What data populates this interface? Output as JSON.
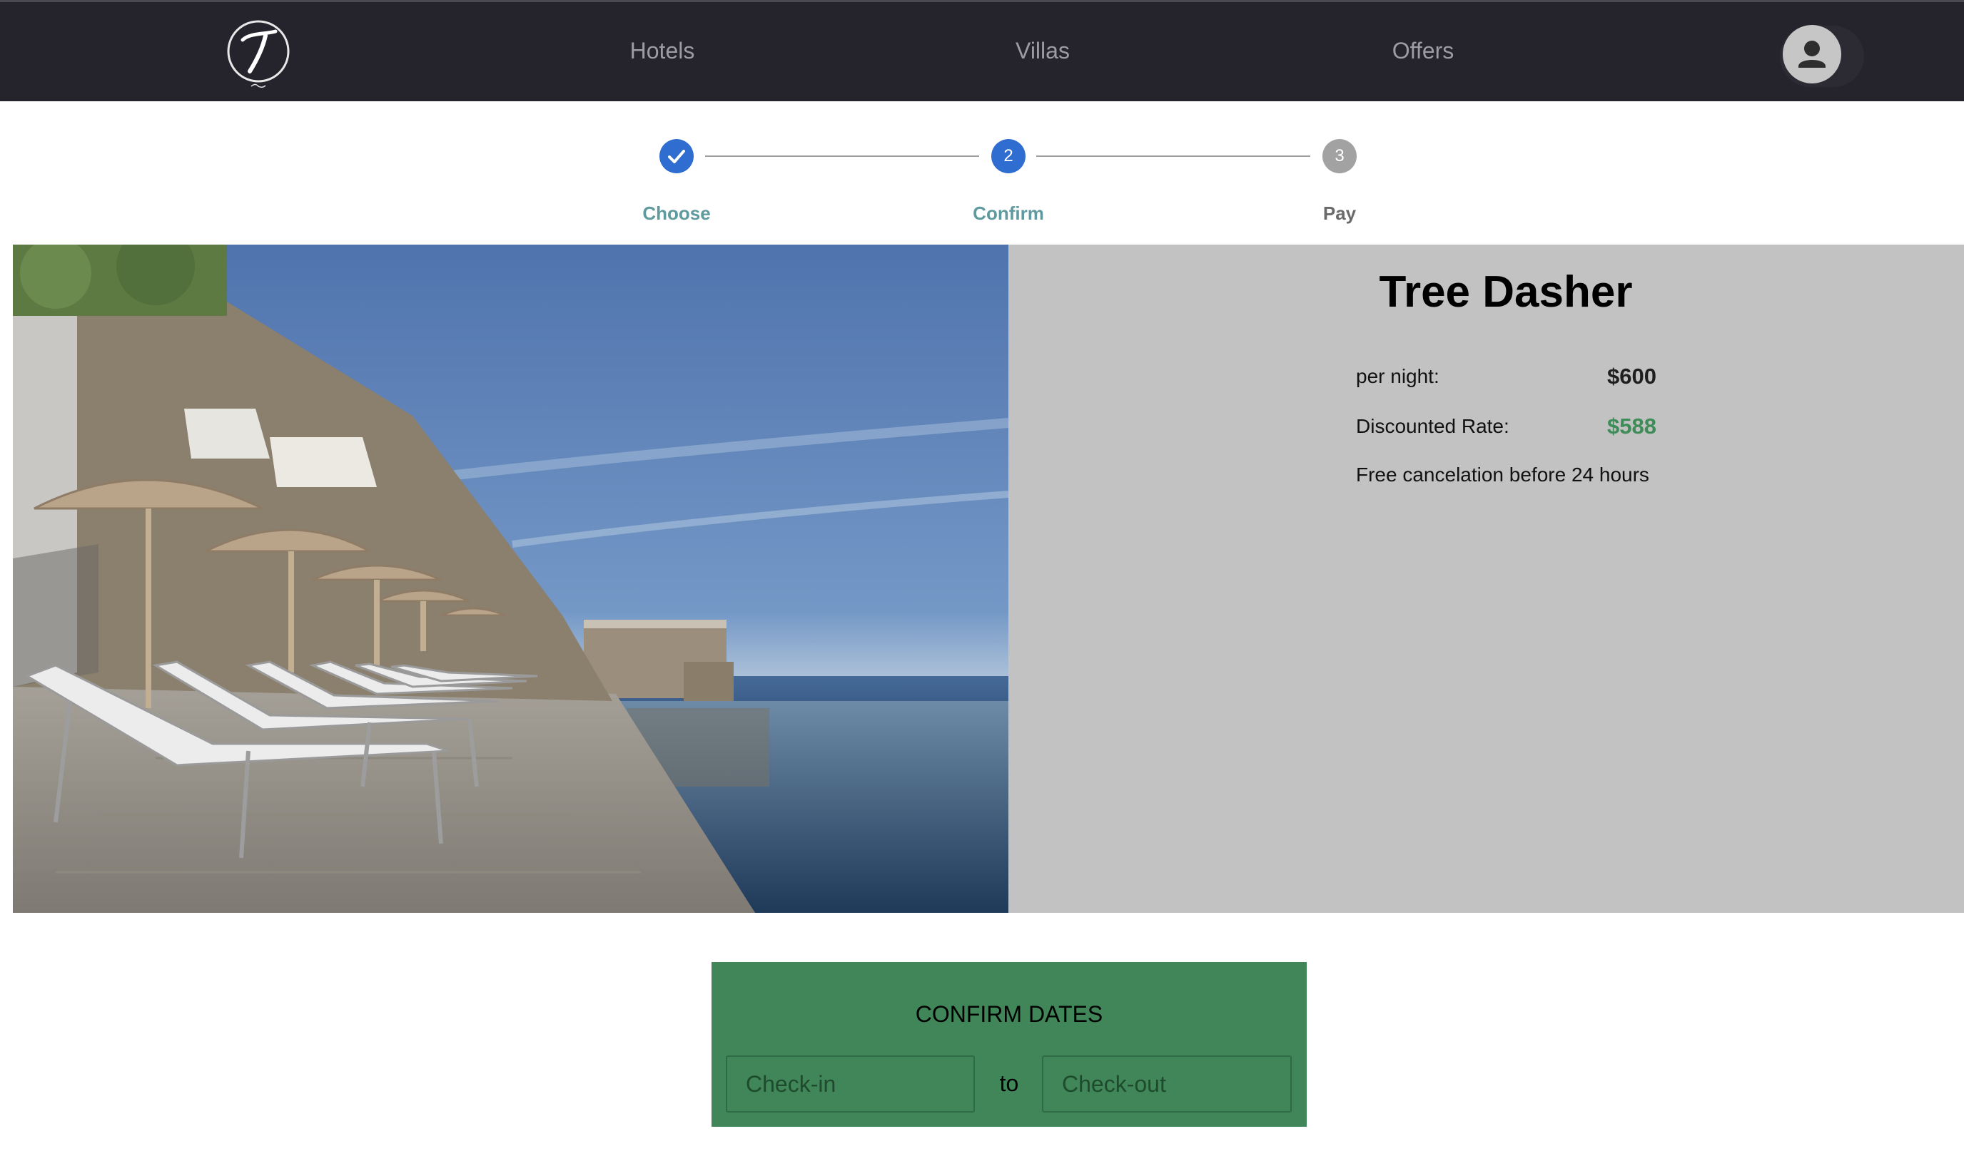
{
  "nav": {
    "links": [
      {
        "label": "Hotels"
      },
      {
        "label": "Villas"
      },
      {
        "label": "Offers"
      }
    ]
  },
  "stepper": {
    "steps": [
      {
        "number": "1",
        "label": "Choose",
        "state": "done"
      },
      {
        "number": "2",
        "label": "Confirm",
        "state": "active"
      },
      {
        "number": "3",
        "label": "Pay",
        "state": "todo"
      }
    ]
  },
  "listing": {
    "name": "Tree Dasher",
    "per_night_label": "per night:",
    "per_night_value": "$600",
    "discount_label": "Discounted Rate:",
    "discount_value": "$588",
    "cancellation_note": "Free cancelation before 24 hours"
  },
  "booking": {
    "title": "CONFIRM DATES",
    "checkin_placeholder": "Check-in",
    "separator": "to",
    "checkout_placeholder": "Check-out"
  },
  "colors": {
    "nav_bg": "#25232c",
    "step_active": "#2f6dd0",
    "step_label_done": "#5e9a9e",
    "step_label_todo": "#6a6a6a",
    "discount_green": "#3e8c57",
    "panel_bg": "#c2c2c2",
    "confirm_bg": "#418658"
  },
  "icons": {
    "logo": "script-t-logo",
    "avatar": "user-icon",
    "step_done": "check-icon"
  }
}
